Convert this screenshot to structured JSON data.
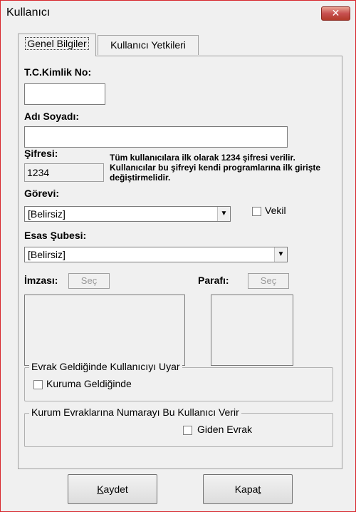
{
  "window": {
    "title": "Kullanıcı",
    "close_glyph": "✕"
  },
  "tabs": [
    {
      "label": "Genel Bilgiler",
      "active": true
    },
    {
      "label": "Kullanıcı Yetkileri",
      "active": false
    }
  ],
  "form": {
    "tc_label": "T.C.Kimlik No:",
    "tc_value": "",
    "name_label": "Adı Soyadı:",
    "name_value": "",
    "password_label": "Şifresi:",
    "password_value": "1234",
    "password_note": "Tüm kullanıcılara ilk olarak 1234 şifresi verilir. Kullanıcılar bu şifreyi kendi programlarına ilk girişte değiştirmelidir.",
    "duty_label": "Görevi:",
    "duty_value": "[Belirsiz]",
    "vekil_label": "Vekil",
    "branch_label": "Esas Şubesi:",
    "branch_value": "[Belirsiz]",
    "signature_label": "İmzası:",
    "signature_button": "Seç",
    "initial_label": "Parafı:",
    "initial_button": "Seç"
  },
  "group_warn": {
    "title": "Evrak Geldiğinde Kullanıcıyı Uyar",
    "checkbox_label": "Kuruma Geldiğinde"
  },
  "group_number": {
    "title": "Kurum Evraklarına Numarayı Bu Kullanıcı Verir",
    "checkbox_label": "Giden Evrak"
  },
  "buttons": {
    "save_prefix": "K",
    "save_rest": "aydet",
    "close_prefix": "Kapa",
    "close_underlined": "t"
  },
  "colors": {
    "window_border": "#d8272d",
    "close_button": "#c75050",
    "background": "#f0f0f0"
  }
}
